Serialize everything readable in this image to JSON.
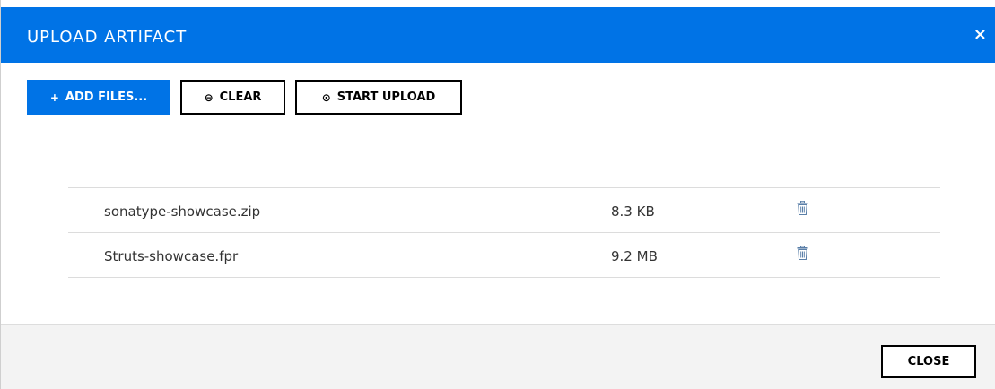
{
  "dialog": {
    "title": "UPLOAD ARTIFACT",
    "close_icon": "×",
    "accent_color": "#0073e6"
  },
  "toolbar": {
    "add_files": {
      "icon": "plus-icon",
      "glyph": "+",
      "label": "ADD FILES..."
    },
    "clear": {
      "icon": "minus-circle-icon",
      "glyph": "⊖",
      "label": "CLEAR"
    },
    "start_upload": {
      "icon": "circle-up-icon",
      "glyph": "⊙",
      "label": "START UPLOAD"
    }
  },
  "files": [
    {
      "name": "sonatype-showcase.zip",
      "size": "8.3 KB",
      "action_icon": "trash-icon"
    },
    {
      "name": "Struts-showcase.fpr",
      "size": "9.2 MB",
      "action_icon": "trash-icon"
    }
  ],
  "footer": {
    "close_label": "CLOSE"
  }
}
